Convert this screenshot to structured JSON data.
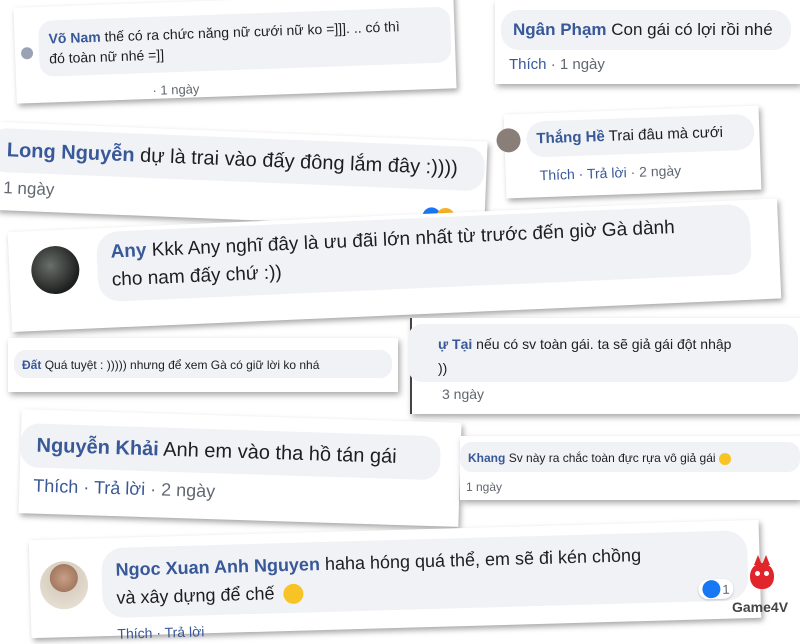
{
  "c1": {
    "name": "Võ Nam",
    "text1": "thế có ra chức năng nữ cưới nữ ko =]]]. .. có thì",
    "text2": "đó toàn nữ nhé =]]",
    "meta": "· 1 ngày"
  },
  "c2": {
    "name": "Ngân Phạm",
    "text": "Con gái có lợi rồi nhé",
    "like": "Thích",
    "time": "· 1 ngày"
  },
  "c3": {
    "name": "Long Nguyễn",
    "text": "dự là trai vào đấy đông lắm đây :))))",
    "time": "1 ngày"
  },
  "c4": {
    "name": "Thắng Hề",
    "text": "Trai đâu mà cưới",
    "like": "Thích",
    "reply": "· Trả lời",
    "time": "· 2 ngày"
  },
  "c5": {
    "name": "Any",
    "text1": "Kkk Any nghĩ đây là ưu đãi lớn nhất từ trước đến giờ Gà dành",
    "text2": "cho nam đấy chứ :))"
  },
  "c6": {
    "name": "Đất",
    "text": "Quá tuyệt : ))))) nhưng để xem Gà có giữ lời ko nhá"
  },
  "c7": {
    "name": "ự Tại",
    "text1": "nếu có sv toàn gái. ta sẽ giả gái đột nhập",
    "text2": "))",
    "time": "3 ngày"
  },
  "c8": {
    "name": "Nguyễn Khải",
    "text": "Anh em vào tha hồ tán gái",
    "like": "Thích",
    "reply": "· Trả lời",
    "time": "· 2 ngày"
  },
  "c9": {
    "name": "Khang",
    "text": "Sv này ra chắc toàn đực rựa vô giả gái",
    "time": "1 ngày"
  },
  "c10": {
    "name": "Ngoc Xuan Anh Nguyen",
    "text1": "haha hóng quá thể, em sẽ đi kén chồng",
    "text2": "và xây dựng để chế",
    "reaction_count": "1",
    "partial_meta": "Thích · Trả lời"
  },
  "brand": {
    "name": "Game4V",
    "color": "#e0252b"
  }
}
